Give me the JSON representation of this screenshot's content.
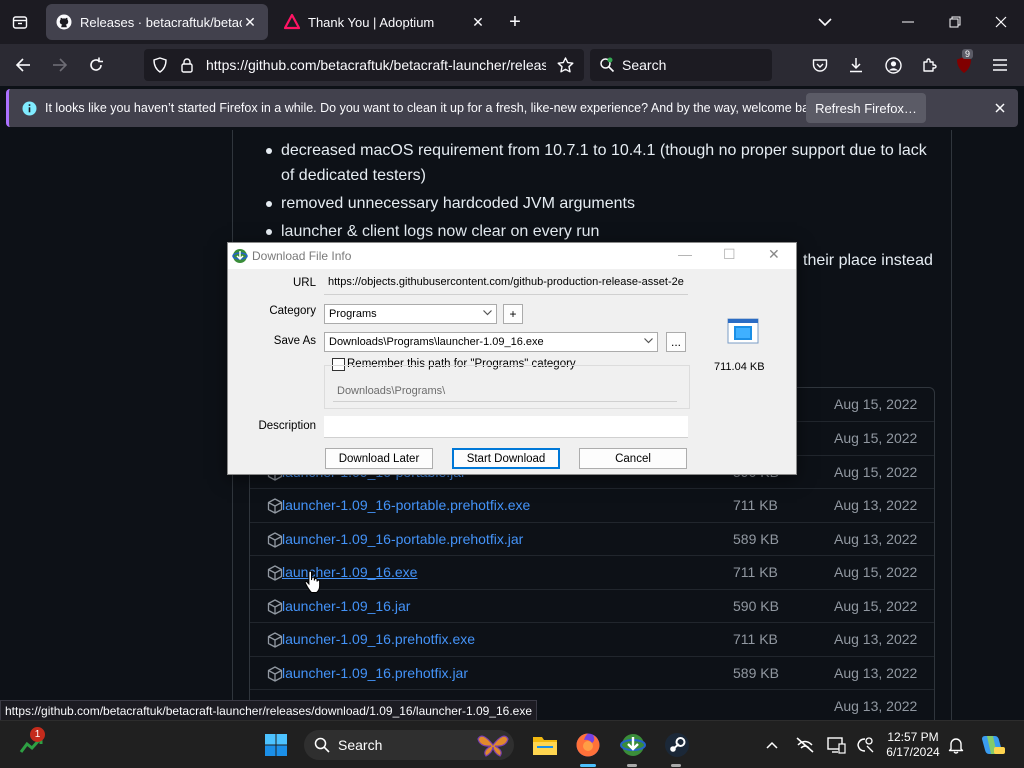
{
  "browser": {
    "tabs": [
      {
        "title": "Releases · betacraftuk/betacraft-launcher",
        "active": true,
        "icon": "github-icon"
      },
      {
        "title": "Thank You | Adoptium",
        "active": false,
        "icon": "adoptium-icon"
      }
    ],
    "url": "https://github.com/betacraftuk/betacraft-launcher/releases",
    "search_placeholder": "Search",
    "extension_badge": "9"
  },
  "notification": {
    "message": "It looks like you haven’t started Firefox in a while. Do you want to clean it up for a fresh, like-new experience? And by the way, welcome back!",
    "button": "Refresh Firefox…"
  },
  "release_notes": [
    "decreased macOS requirement from 10.7.1 to 10.4.1 (though no proper support due to lack of dedicated testers)",
    "removed unnecessary hardcoded JVM arguments",
    "launcher & client logs now clear on every run",
    "their place instead"
  ],
  "assets": [
    {
      "name": "",
      "size": "",
      "date": "Aug 15, 2022"
    },
    {
      "name": "",
      "size": "",
      "date": "Aug 15, 2022"
    },
    {
      "name": "launcher-1.09_16-portable.jar",
      "size": "590 KB",
      "date": "Aug 15, 2022"
    },
    {
      "name": "launcher-1.09_16-portable.prehotfix.exe",
      "size": "711 KB",
      "date": "Aug 13, 2022"
    },
    {
      "name": "launcher-1.09_16-portable.prehotfix.jar",
      "size": "589 KB",
      "date": "Aug 13, 2022"
    },
    {
      "name": "launcher-1.09_16.exe",
      "size": "711 KB",
      "date": "Aug 15, 2022"
    },
    {
      "name": "launcher-1.09_16.jar",
      "size": "590 KB",
      "date": "Aug 15, 2022"
    },
    {
      "name": "launcher-1.09_16.prehotfix.exe",
      "size": "711 KB",
      "date": "Aug 13, 2022"
    },
    {
      "name": "launcher-1.09_16.prehotfix.jar",
      "size": "589 KB",
      "date": "Aug 13, 2022"
    },
    {
      "name": "",
      "size": "",
      "date": "Aug 13, 2022"
    }
  ],
  "status_url": "https://github.com/betacraftuk/betacraft-launcher/releases/download/1.09_16/launcher-1.09_16.exe",
  "dialog": {
    "title": "Download File Info",
    "url_label": "URL",
    "url_value": "https://objects.githubusercontent.com/github-production-release-asset-2e",
    "category_label": "Category",
    "category_value": "Programs",
    "add_button": "+",
    "save_as_label": "Save As",
    "save_as_value": "Downloads\\Programs\\launcher-1.09_16.exe",
    "browse_button": "...",
    "remember_label": "Remember this path for \"Programs\" category",
    "path_preview": "Downloads\\Programs\\",
    "description_label": "Description",
    "description_value": "",
    "file_size": "711.04 KB",
    "buttons": {
      "later": "Download Later",
      "start": "Start Download",
      "cancel": "Cancel"
    }
  },
  "taskbar": {
    "search_placeholder": "Search",
    "widget_badge": "1",
    "time": "12:57 PM",
    "date": "6/17/2024"
  },
  "colors": {
    "link": "#4493f8",
    "page_bg": "#0d1117",
    "accent": "#ab71ff"
  }
}
